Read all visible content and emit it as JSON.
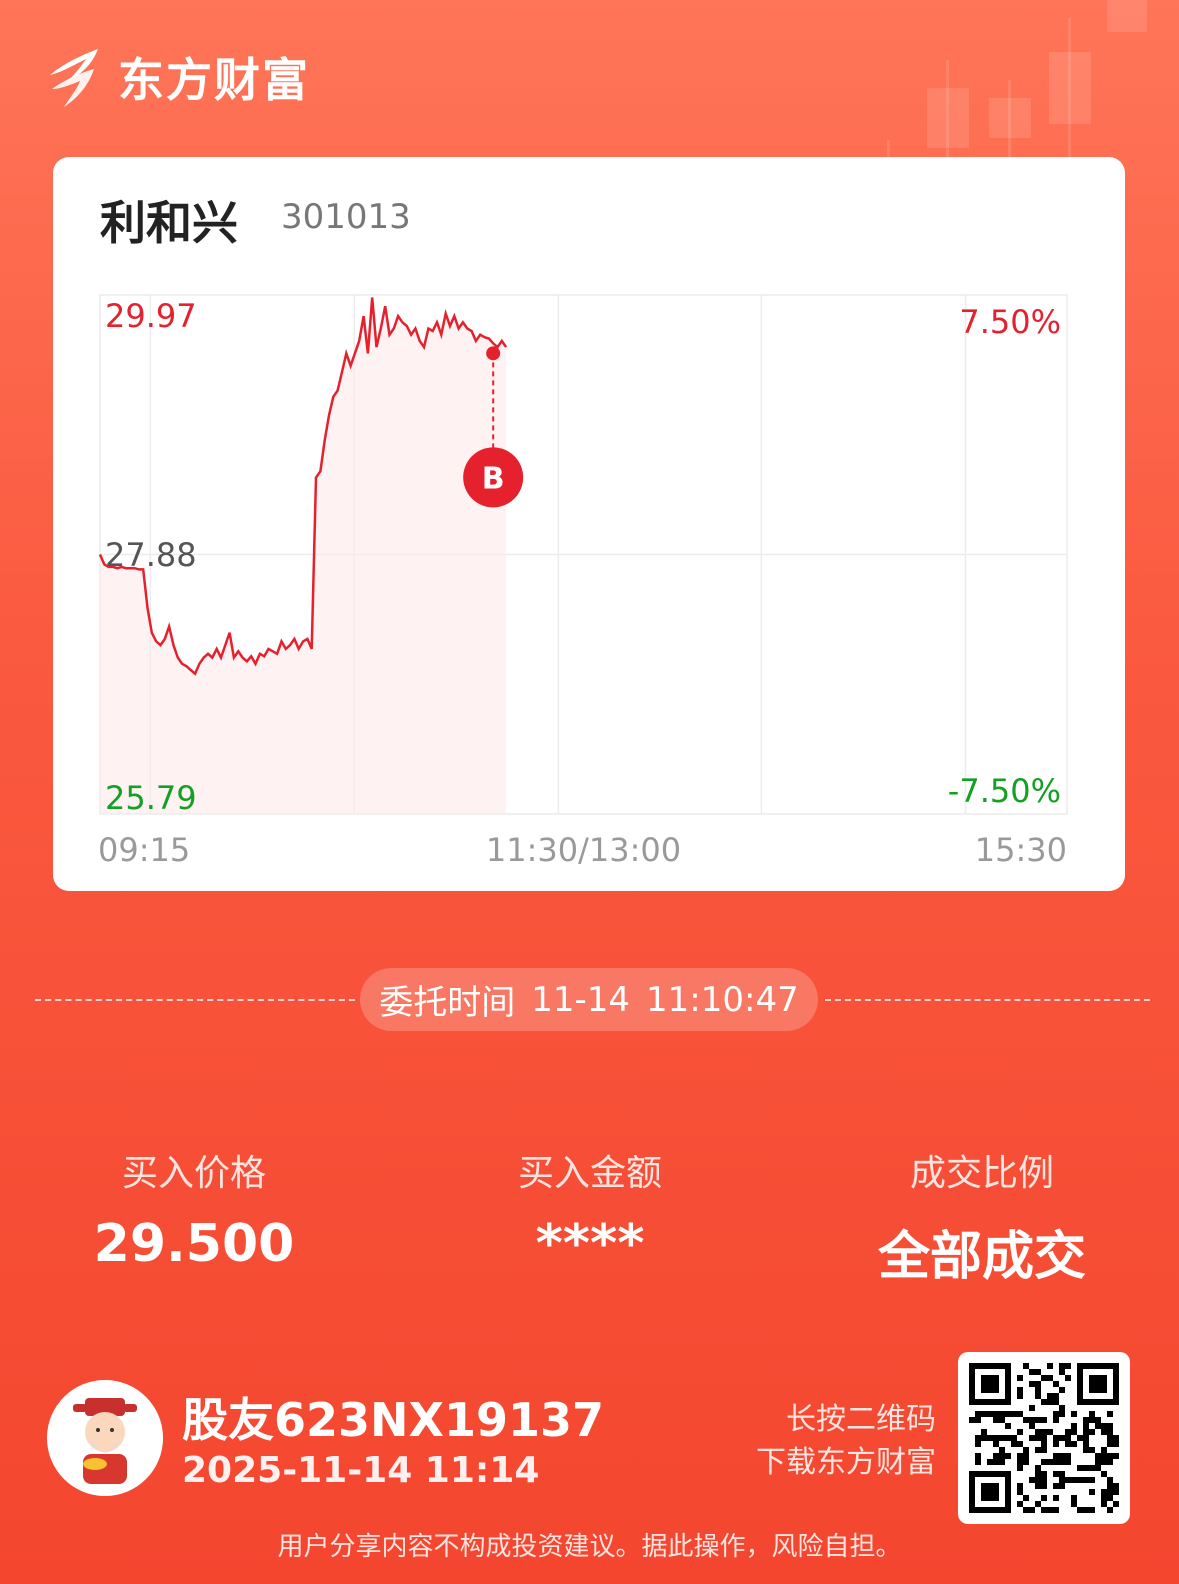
{
  "brand": {
    "name": "东方财富"
  },
  "stock": {
    "name": "利和兴",
    "code": "301013"
  },
  "chart_data": {
    "type": "line",
    "series": [
      {
        "values": [
          27.88,
          27.8,
          27.78,
          27.78,
          27.77,
          27.78,
          27.77,
          27.77,
          27.77,
          27.76,
          27.76,
          27.45,
          27.25,
          27.18,
          27.15,
          27.2,
          27.3,
          27.15,
          27.05,
          27.0,
          26.98,
          26.95,
          26.92,
          27.0,
          27.05,
          27.08,
          27.05,
          27.12,
          27.05,
          27.15,
          27.25,
          27.05,
          27.1,
          27.05,
          27.02,
          27.06,
          27.0,
          27.08,
          27.06,
          27.12,
          27.1,
          27.08,
          27.18,
          27.12,
          27.15,
          27.2,
          27.12,
          27.18,
          27.2,
          27.12,
          28.5,
          28.55,
          28.8,
          29.0,
          29.15,
          29.2,
          29.35,
          29.5,
          29.4,
          29.5,
          29.6,
          29.8,
          29.5,
          29.95,
          29.55,
          29.7,
          29.88,
          29.65,
          29.7,
          29.8,
          29.75,
          29.72,
          29.65,
          29.7,
          29.6,
          29.55,
          29.7,
          29.68,
          29.75,
          29.65,
          29.82,
          29.72,
          29.8,
          29.7,
          29.75,
          29.7,
          29.68,
          29.6,
          29.65,
          29.63,
          29.62,
          29.58,
          29.55,
          29.6,
          29.55
        ]
      }
    ],
    "y_ticks": {
      "high": "29.97",
      "mid": "27.88",
      "low": "25.79"
    },
    "pct_ticks": {
      "high": "7.50%",
      "low": "-7.50%"
    },
    "x_ticks": {
      "start": "09:15",
      "mid": "11:30/13:00",
      "end": "15:30"
    },
    "ylim": [
      25.79,
      29.97
    ],
    "session_fraction_elapsed": 0.42,
    "buy_marker": {
      "label": "B",
      "price": 29.5
    },
    "colors": {
      "line": "#e4212d",
      "up": "#e4212d",
      "down": "#13a024",
      "neutral": "#555555"
    }
  },
  "entrust": {
    "label": "委托时间",
    "date": "11-14",
    "time": "11:10:47"
  },
  "stats": [
    {
      "label": "买入价格",
      "value": "29.500"
    },
    {
      "label": "买入金额",
      "value": "****"
    },
    {
      "label": "成交比例",
      "value": "全部成交"
    }
  ],
  "user": {
    "name": "股友623NX19137",
    "datetime": "2025-11-14 11:14"
  },
  "qr": {
    "hint_line1": "长按二维码",
    "hint_line2": "下载东方财富"
  },
  "disclaimer": "用户分享内容不构成投资建议。据此操作，风险自担。"
}
